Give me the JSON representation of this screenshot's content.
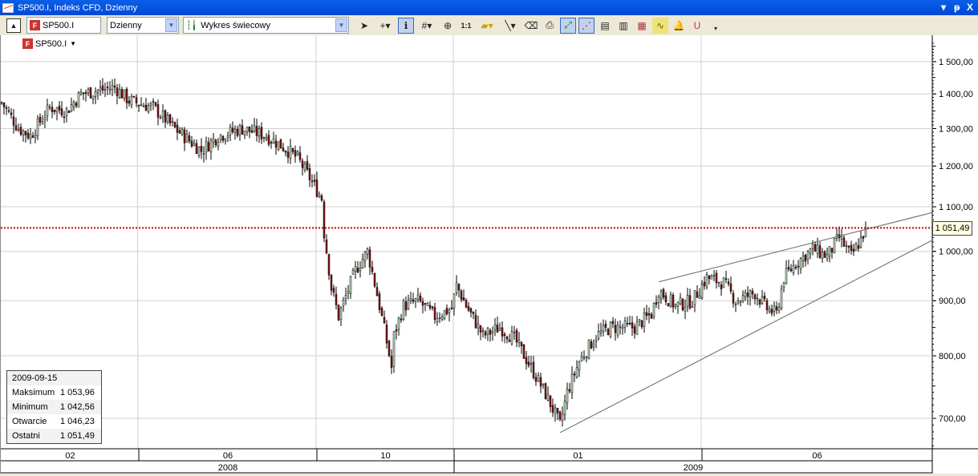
{
  "window": {
    "title": "SP500.I, Indeks CFD, Dzienny",
    "btn_menu": "▾",
    "btn_pin": "ᵽ",
    "btn_close": "X"
  },
  "toolbar": {
    "symbol": "SP500.I",
    "interval": "Dzienny",
    "chart_type": "Wykres świecowy",
    "zoom_11": "1:1",
    "icons": [
      "pointer-icon",
      "crosshair-icon",
      "info-icon",
      "grid-icon",
      "zoom-icon",
      "one-to-one-icon",
      "folder-icon",
      "line-icon",
      "eraser-icon",
      "print-icon",
      "autoscale-icon",
      "trend-icon",
      "copy-chart-icon",
      "paste-chart-icon",
      "template-icon",
      "indicator-icon",
      "alert-bell-icon",
      "magnet-icon"
    ]
  },
  "symbol_label": "SP500.I",
  "info": {
    "date": "2009-09-15",
    "rows": [
      {
        "k": "Maksimum",
        "v": "1 053,96"
      },
      {
        "k": "Minimum",
        "v": "1 042,56"
      },
      {
        "k": "Otwarcie",
        "v": "1 046,23"
      },
      {
        "k": "Ostatni",
        "v": "1 051,49"
      }
    ]
  },
  "last_price_label": "1 051,49",
  "colors": {
    "up": "#c6e4c6",
    "down": "#8b1111",
    "last_line": "#cc0000",
    "grid": "#d0d0d0"
  },
  "chart_data": {
    "type": "candlestick",
    "scale": "log",
    "y_ticks": [
      {
        "v": 700,
        "l": "700,00"
      },
      {
        "v": 800,
        "l": "800,00"
      },
      {
        "v": 900,
        "l": "900,00"
      },
      {
        "v": 1000,
        "l": "1 000,00"
      },
      {
        "v": 1100,
        "l": "1 100,00"
      },
      {
        "v": 1200,
        "l": "1 200,00"
      },
      {
        "v": 1300,
        "l": "1 300,00"
      },
      {
        "v": 1400,
        "l": "1 400,00"
      },
      {
        "v": 1500,
        "l": "1 500,00"
      }
    ],
    "month_labels": [
      {
        "l": "02",
        "from": 0,
        "to": 57
      },
      {
        "l": "06",
        "from": 57,
        "to": 131
      },
      {
        "l": "10",
        "from": 131,
        "to": 188
      },
      {
        "l": "01",
        "from": 188,
        "to": 291
      },
      {
        "l": "06",
        "from": 291,
        "to": 387
      }
    ],
    "year_labels": [
      {
        "l": "2008",
        "from": 0,
        "to": 188
      },
      {
        "l": "2009",
        "from": 188,
        "to": 387
      }
    ],
    "close_path": [
      [
        0,
        1374
      ],
      [
        7,
        1301
      ],
      [
        12,
        1280
      ],
      [
        20,
        1360
      ],
      [
        27,
        1350
      ],
      [
        33,
        1400
      ],
      [
        47,
        1420
      ],
      [
        53,
        1380
      ],
      [
        63,
        1360
      ],
      [
        72,
        1300
      ],
      [
        83,
        1240
      ],
      [
        90,
        1280
      ],
      [
        100,
        1300
      ],
      [
        110,
        1280
      ],
      [
        117,
        1250
      ],
      [
        123,
        1220
      ],
      [
        128,
        1170
      ],
      [
        133,
        1120
      ],
      [
        134,
        1040
      ],
      [
        137,
        925
      ],
      [
        140,
        870
      ],
      [
        147,
        960
      ],
      [
        152,
        1000
      ],
      [
        157,
        890
      ],
      [
        162,
        780
      ],
      [
        163,
        835
      ],
      [
        167,
        890
      ],
      [
        173,
        900
      ],
      [
        180,
        870
      ],
      [
        187,
        885
      ],
      [
        189,
        930
      ],
      [
        193,
        890
      ],
      [
        200,
        835
      ],
      [
        207,
        850
      ],
      [
        213,
        830
      ],
      [
        220,
        780
      ],
      [
        227,
        730
      ],
      [
        232,
        690
      ],
      [
        235,
        740
      ],
      [
        240,
        790
      ],
      [
        247,
        835
      ],
      [
        253,
        850
      ],
      [
        263,
        850
      ],
      [
        270,
        875
      ],
      [
        273,
        920
      ],
      [
        280,
        890
      ],
      [
        287,
        900
      ],
      [
        293,
        945
      ],
      [
        300,
        935
      ],
      [
        305,
        900
      ],
      [
        313,
        915
      ],
      [
        318,
        885
      ],
      [
        322,
        875
      ],
      [
        325,
        945
      ],
      [
        330,
        975
      ],
      [
        337,
        1005
      ],
      [
        343,
        990
      ],
      [
        348,
        1030
      ],
      [
        353,
        990
      ],
      [
        357,
        1025
      ],
      [
        359,
        1051.49
      ]
    ],
    "last": 1051.49,
    "trendlines": [
      {
        "from": [
          232,
          679
        ],
        "to": [
          387,
          1025
        ]
      },
      {
        "from": [
          273,
          937
        ],
        "to": [
          387,
          1087
        ]
      }
    ]
  }
}
